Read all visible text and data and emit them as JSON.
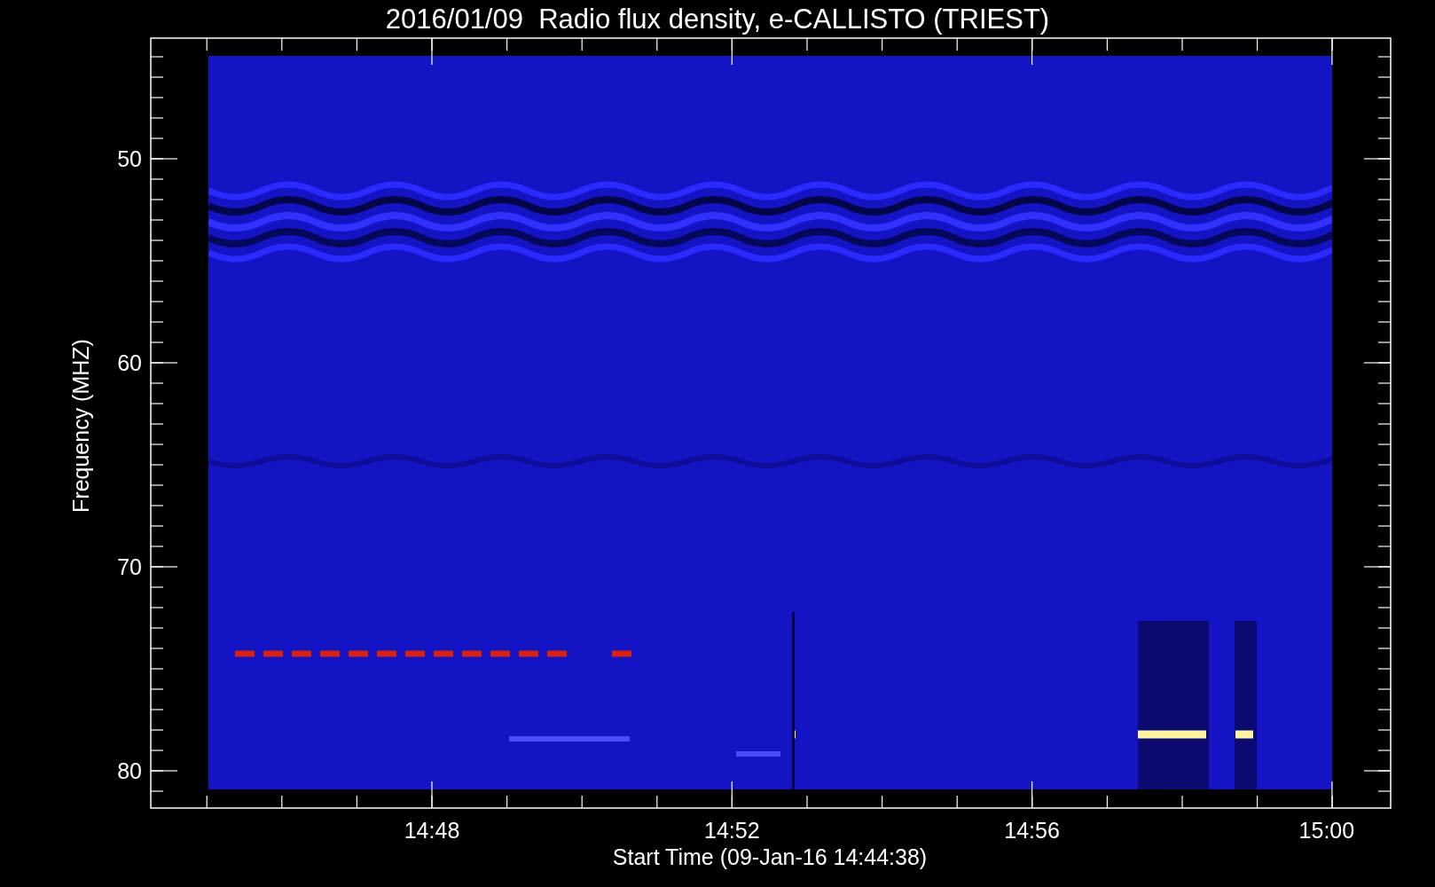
{
  "title": "2016/01/09  Radio flux density, e-CALLISTO (TRIEST)",
  "y_axis": {
    "label": "Frequency (MHZ)",
    "ticks": [
      "50",
      "60",
      "70",
      "80"
    ]
  },
  "x_axis": {
    "label": "Start Time (09-Jan-16 14:44:38)",
    "ticks": [
      "14:48",
      "14:52",
      "14:56",
      "15:00"
    ]
  }
}
